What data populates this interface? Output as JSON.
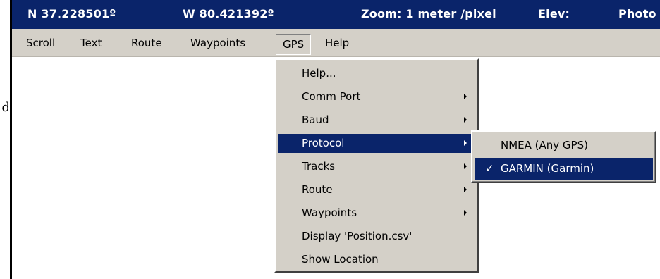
{
  "doc_fragment": "d",
  "statusbar": {
    "latitude": "N 37.228501º",
    "longitude": "W 80.421392º",
    "zoom": "Zoom: 1 meter /pixel",
    "elevation": "Elev:",
    "photo": "Photo"
  },
  "menubar": {
    "items": [
      "Scroll",
      "Text",
      "Route",
      "Waypoints",
      "GPS",
      "Help"
    ],
    "active": "GPS"
  },
  "gps_menu": {
    "items": [
      {
        "label": "Help...",
        "has_submenu": false
      },
      {
        "label": "Comm Port",
        "has_submenu": true
      },
      {
        "label": "Baud",
        "has_submenu": true
      },
      {
        "label": "Protocol",
        "has_submenu": true,
        "highlighted": true
      },
      {
        "label": "Tracks",
        "has_submenu": true
      },
      {
        "label": "Route",
        "has_submenu": true
      },
      {
        "label": "Waypoints",
        "has_submenu": true
      },
      {
        "label": "Display 'Position.csv'",
        "has_submenu": false
      },
      {
        "label": "Show Location",
        "has_submenu": false
      }
    ]
  },
  "protocol_submenu": {
    "items": [
      {
        "label": "NMEA (Any GPS)",
        "checked": false
      },
      {
        "label": "GARMIN (Garmin)",
        "checked": true,
        "highlighted": true
      }
    ],
    "check_glyph": "✓"
  },
  "colors": {
    "title_blue": "#0a246a",
    "menu_gray": "#d4d0c8",
    "highlight_text": "#ffffff"
  },
  "icons": {
    "submenu_arrow": "triangle-right-icon",
    "checkmark": "checkmark-icon"
  }
}
